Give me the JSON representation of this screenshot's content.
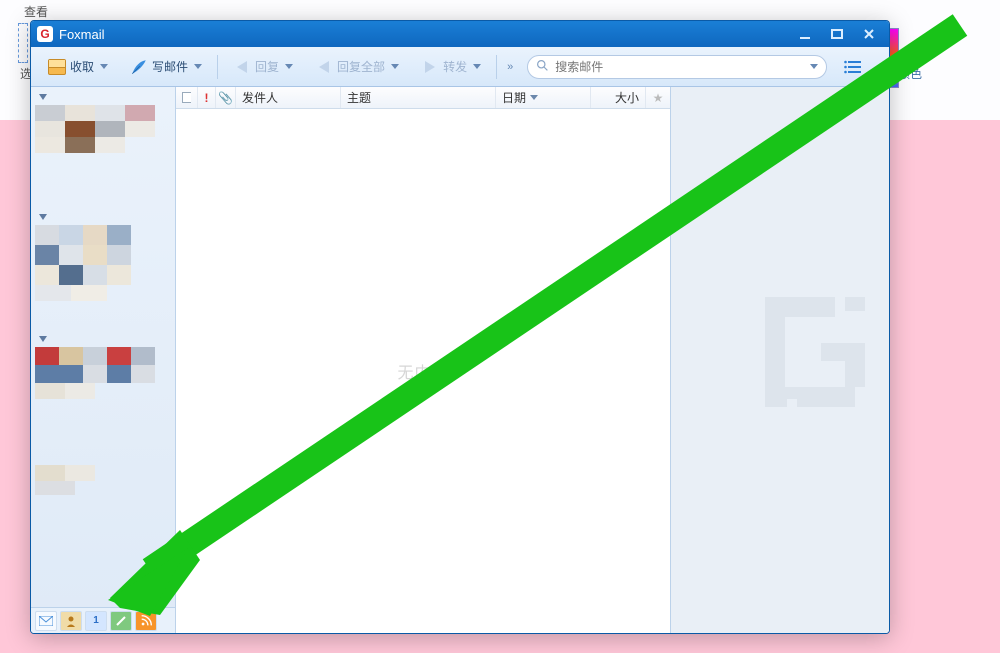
{
  "background": {
    "label_view": "查看",
    "label_select": "选",
    "label_color": "颜色"
  },
  "window": {
    "title": "Foxmail",
    "logo_letter": "G"
  },
  "toolbar": {
    "receive": "收取",
    "compose": "写邮件",
    "reply": "回复",
    "reply_all": "回复全部",
    "forward": "转发",
    "search_placeholder": "搜索邮件"
  },
  "columns": {
    "flag": "!",
    "attach": "📎",
    "sender": "发件人",
    "subject": "主题",
    "date": "日期",
    "size": "大小",
    "star": "★"
  },
  "list": {
    "empty_text": "无内容"
  },
  "side_icons": {
    "calendar_num": "1"
  }
}
